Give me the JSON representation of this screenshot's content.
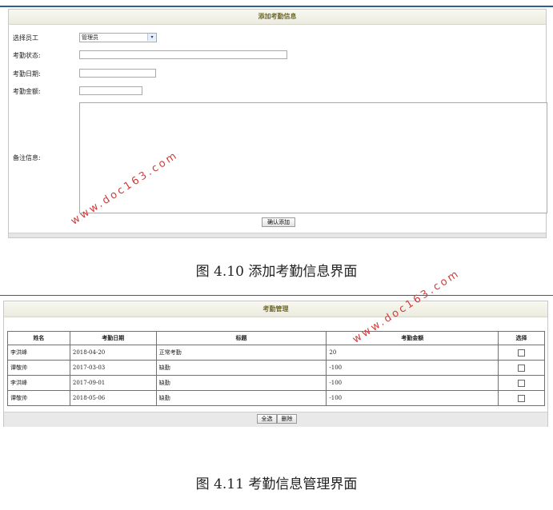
{
  "add_form": {
    "title": "添加考勤信息",
    "employee_label": "选择员工",
    "employee_value": "管理员",
    "status_label": "考勤状态:",
    "status_value": "",
    "date_label": "考勤日期:",
    "date_value": "",
    "amount_label": "考勤金额:",
    "amount_value": "",
    "remark_label": "备注信息:",
    "submit_label": "确认添加"
  },
  "caption1": "图 4.10  添加考勤信息界面",
  "manage": {
    "title": "考勤管理",
    "headers": [
      "姓名",
      "考勤日期",
      "标题",
      "考勤金额",
      "选择"
    ],
    "rows": [
      {
        "name": "李洪峰",
        "date": "2018-04-20",
        "title": "正常考勤",
        "amount": "20"
      },
      {
        "name": "谭敬帅",
        "date": "2017-03-03",
        "title": "缺勤",
        "amount": "-100"
      },
      {
        "name": "李洪峰",
        "date": "2017-09-01",
        "title": "缺勤",
        "amount": "-100"
      },
      {
        "name": "谭敬帅",
        "date": "2018-05-06",
        "title": "缺勤",
        "amount": "-100"
      }
    ],
    "select_all_label": "全选",
    "delete_label": "删除"
  },
  "caption2": "图 4.11  考勤信息管理界面",
  "watermark": "www.doc163.com",
  "colors": {
    "watermark": "#d23a3a",
    "title_text": "#6f6a2a",
    "rule_line": "#2f5f96"
  }
}
